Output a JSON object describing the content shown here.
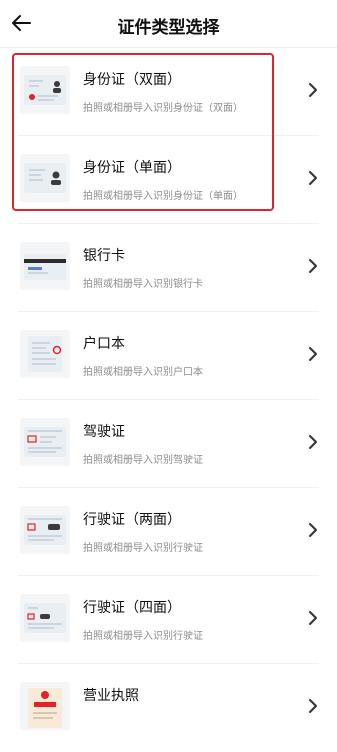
{
  "header": {
    "title": "证件类型选择",
    "back_icon": "arrow-left-icon"
  },
  "colors": {
    "highlight": "#e0242a",
    "text": "#111111",
    "desc": "#8c8c8c"
  },
  "items": [
    {
      "name": "身份证（双面）",
      "desc": "拍照或相册导入识别身份证（双面）",
      "icon": "id-card-icon"
    },
    {
      "name": "身份证（单面）",
      "desc": "拍照或相册导入识别身份证（单面）",
      "icon": "id-card-front-icon"
    },
    {
      "name": "银行卡",
      "desc": "拍照或相册导入识别银行卡",
      "icon": "bank-card-icon"
    },
    {
      "name": "户口本",
      "desc": "拍照或相册导入识别户口本",
      "icon": "household-register-icon"
    },
    {
      "name": "驾驶证",
      "desc": "拍照或相册导入识别驾驶证",
      "icon": "driver-license-icon"
    },
    {
      "name": "行驶证（两面）",
      "desc": "拍照或相册导入识别行驶证",
      "icon": "vehicle-license-icon"
    },
    {
      "name": "行驶证（四面）",
      "desc": "拍照或相册导入识别行驶证",
      "icon": "vehicle-license-four-icon"
    },
    {
      "name": "营业执照",
      "desc": "",
      "icon": "business-license-icon"
    }
  ]
}
